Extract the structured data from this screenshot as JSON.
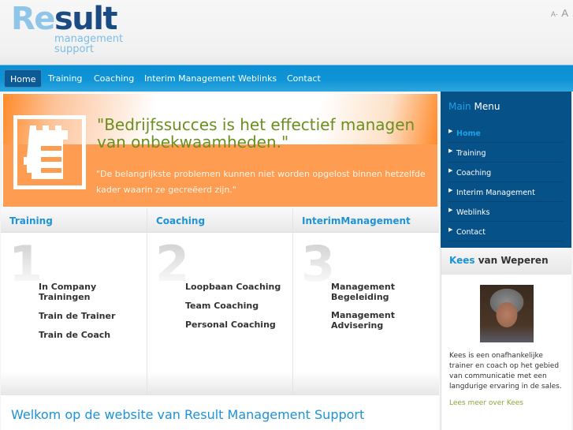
{
  "header": {
    "logo": {
      "part1": "Re",
      "part2": "sult",
      "sub1": "management",
      "sub2": "support"
    },
    "font_size": {
      "smaller": "A-",
      "larger": "A"
    }
  },
  "nav": {
    "items": [
      {
        "label": "Home",
        "active": true
      },
      {
        "label": "Training"
      },
      {
        "label": "Coaching"
      },
      {
        "label": "Interim Management"
      },
      {
        "label": "Weblinks"
      },
      {
        "label": "Contact"
      }
    ]
  },
  "hero": {
    "icon": "castle-notepad-icon",
    "quote": "\"Bedrijfssucces is het effectief managen van onbekwaamheden.\"",
    "subquote": "\"De belangrijkste problemen kunnen niet worden opgelost binnen hetzelfde kader waarin ze gecreëerd zijn.\""
  },
  "columns": [
    {
      "title": "Training",
      "number": "1",
      "links": [
        "In Company Trainingen",
        "Train de Trainer",
        "Train de Coach"
      ]
    },
    {
      "title": "Coaching",
      "number": "2",
      "links": [
        "Loopbaan Coaching",
        "Team Coaching",
        "Personal Coaching"
      ]
    },
    {
      "title": "InterimManagement",
      "number": "3",
      "links": [
        "Management Begeleiding",
        "Management Advisering"
      ]
    }
  ],
  "welcome": {
    "title": "Welkom op de website van Result Management Support"
  },
  "sidebar": {
    "title_highlight": "Main",
    "title_rest": " Menu",
    "items": [
      {
        "label": "Home",
        "active": true
      },
      {
        "label": "Training"
      },
      {
        "label": "Coaching"
      },
      {
        "label": "Interim Management"
      },
      {
        "label": "Weblinks"
      },
      {
        "label": "Contact"
      }
    ]
  },
  "profile": {
    "name_first": "Kees",
    "name_rest": " van Weperen",
    "bio": "Kees is een onafhankelijke trainer en coach op het gebied van communicatie met een langdurige ervaring in de sales.",
    "link": "Lees meer over Kees"
  }
}
